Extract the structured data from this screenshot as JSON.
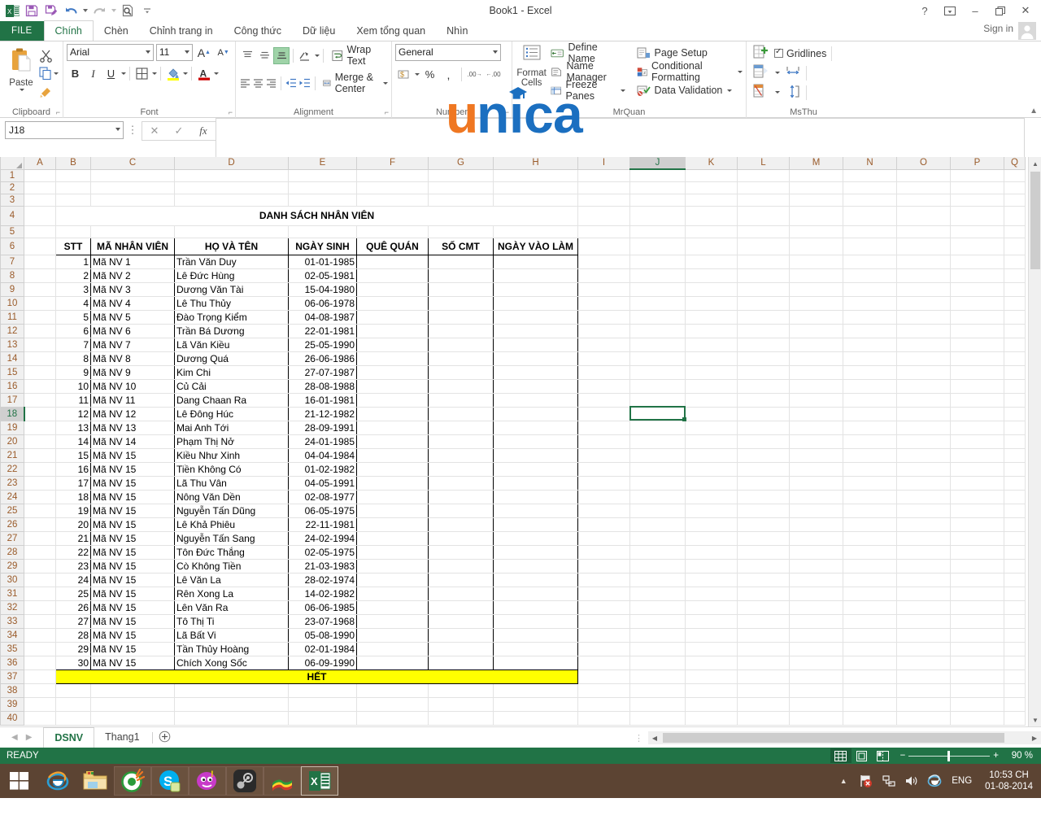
{
  "window": {
    "title": "Book1 - Excel",
    "qat": [
      {
        "name": "excel-logo-icon",
        "label": "Excel"
      },
      {
        "name": "save-icon",
        "label": "Save"
      },
      {
        "name": "save-as-icon",
        "label": "Save As"
      },
      {
        "name": "undo-icon",
        "label": "Undo"
      },
      {
        "name": "redo-icon",
        "label": "Redo"
      },
      {
        "name": "print-preview-icon",
        "label": "Print Preview"
      },
      {
        "name": "customize-qat-icon",
        "label": "Customize Quick Access Toolbar"
      }
    ],
    "buttons": {
      "help": "?",
      "ribbon_display": "ribbon-display-options",
      "minimize": "–",
      "restore": "restore",
      "close": "✕"
    },
    "sign_in": "Sign in"
  },
  "ribbon": {
    "file_tab": "FILE",
    "tabs": [
      {
        "label": "Chính",
        "active": true
      },
      {
        "label": "Chèn",
        "active": false
      },
      {
        "label": "Chỉnh trang in",
        "active": false
      },
      {
        "label": "Công thức",
        "active": false
      },
      {
        "label": "Dữ liệu",
        "active": false
      },
      {
        "label": "Xem tổng quan",
        "active": false
      },
      {
        "label": "Nhìn",
        "active": false
      }
    ],
    "groups": {
      "clipboard": {
        "label": "Clipboard",
        "paste": "Paste",
        "cut": "cut-icon",
        "copy": "copy-icon",
        "format_painter": "format-painter-icon"
      },
      "font": {
        "label": "Font",
        "font_name": "Arial",
        "font_size": "11",
        "grow_font": "A",
        "shrink_font": "A",
        "bold": "B",
        "italic": "I",
        "underline": "U",
        "borders": "borders-icon",
        "fill_color": "fill-color-icon",
        "font_color": "font-color-icon"
      },
      "alignment": {
        "label": "Alignment",
        "wrap_text": "Wrap Text",
        "merge_center": "Merge & Center",
        "orientation": "orientation-icon",
        "decrease_indent": "decrease-indent-icon",
        "increase_indent": "increase-indent-icon"
      },
      "number": {
        "label": "Number",
        "format": "General",
        "accounting": "accounting-icon",
        "percent": "%",
        "comma": ",",
        "increase_decimal": ".00",
        "decrease_decimal": ".00"
      },
      "mrquan": {
        "label": "MrQuan",
        "format_cells": "Format Cells",
        "items_left": [
          {
            "label": "Define Name",
            "icon": "define-name-icon"
          },
          {
            "label": "Name Manager",
            "icon": "name-manager-icon"
          },
          {
            "label": "Freeze Panes",
            "icon": "freeze-panes-icon",
            "dropdown": true
          }
        ],
        "items_right": [
          {
            "label": "Page Setup",
            "icon": "page-setup-icon"
          },
          {
            "label": "Conditional Formatting",
            "icon": "conditional-formatting-icon",
            "dropdown": true
          },
          {
            "label": "Data Validation",
            "icon": "data-validation-icon",
            "dropdown": true
          }
        ]
      },
      "msthu": {
        "label": "MsThu",
        "gridlines": "Gridlines",
        "gridlines_checked": true,
        "insert_cells": "insert-cells-icon",
        "format_cells2": "format-cells-icon",
        "delete_cells": "delete-cells-icon",
        "row_height": "row-height-icon",
        "column_width": "column-width-icon"
      }
    },
    "watermark_text": "unica"
  },
  "formula_bar": {
    "name_box": "J18",
    "cancel": "✕",
    "enter": "✓",
    "insert_function": "fx",
    "content": ""
  },
  "grid": {
    "columns": [
      "A",
      "B",
      "C",
      "D",
      "E",
      "F",
      "G",
      "H",
      "I",
      "J",
      "K",
      "L",
      "M",
      "N",
      "O",
      "P",
      "Q"
    ],
    "selected_column": "J",
    "selected_row": 18,
    "selected_cell": "J18",
    "title_row": 4,
    "title": "DANH SÁCH NHÂN VIÊN",
    "headers": [
      "STT",
      "MÃ NHÂN VIÊN",
      "HỌ VÀ TÊN",
      "NGÀY SINH",
      "QUÊ QUÁN",
      "SỐ CMT",
      "NGÀY VÀO LÀM"
    ],
    "header_row": 6,
    "footer_text": "HẾT",
    "footer_row": 37,
    "rows": [
      {
        "row": 7,
        "stt": "1",
        "ma": "Mã NV 1",
        "ten": "Trần Văn Duy",
        "ns": "01-01-1985"
      },
      {
        "row": 8,
        "stt": "2",
        "ma": "Mã NV 2",
        "ten": "Lê Đức Hùng",
        "ns": "02-05-1981"
      },
      {
        "row": 9,
        "stt": "3",
        "ma": "Mã NV 3",
        "ten": "Dương Văn Tài",
        "ns": "15-04-1980"
      },
      {
        "row": 10,
        "stt": "4",
        "ma": "Mã NV 4",
        "ten": "Lê Thu Thủy",
        "ns": "06-06-1978"
      },
      {
        "row": 11,
        "stt": "5",
        "ma": "Mã NV 5",
        "ten": "Đào Trọng Kiểm",
        "ns": "04-08-1987"
      },
      {
        "row": 12,
        "stt": "6",
        "ma": "Mã NV 6",
        "ten": "Trần Bá Dương",
        "ns": "22-01-1981"
      },
      {
        "row": 13,
        "stt": "7",
        "ma": "Mã NV 7",
        "ten": "Lã Văn Kiều",
        "ns": "25-05-1990"
      },
      {
        "row": 14,
        "stt": "8",
        "ma": "Mã NV 8",
        "ten": "Dương Quá",
        "ns": "26-06-1986"
      },
      {
        "row": 15,
        "stt": "9",
        "ma": "Mã NV 9",
        "ten": "Kim Chi",
        "ns": "27-07-1987"
      },
      {
        "row": 16,
        "stt": "10",
        "ma": "Mã NV 10",
        "ten": "Củ Cải",
        "ns": "28-08-1988"
      },
      {
        "row": 17,
        "stt": "11",
        "ma": "Mã NV 11",
        "ten": "Dang Chaan Ra",
        "ns": "16-01-1981"
      },
      {
        "row": 18,
        "stt": "12",
        "ma": "Mã NV 12",
        "ten": "Lê Đông Húc",
        "ns": "21-12-1982"
      },
      {
        "row": 19,
        "stt": "13",
        "ma": "Mã NV 13",
        "ten": "Mai Anh Tới",
        "ns": "28-09-1991"
      },
      {
        "row": 20,
        "stt": "14",
        "ma": "Mã NV 14",
        "ten": "Phạm Thị Nở",
        "ns": "24-01-1985"
      },
      {
        "row": 21,
        "stt": "15",
        "ma": "Mã NV 15",
        "ten": "Kiều Như Xinh",
        "ns": "04-04-1984"
      },
      {
        "row": 22,
        "stt": "16",
        "ma": "Mã NV 15",
        "ten": "Tiền Không Có",
        "ns": "01-02-1982"
      },
      {
        "row": 23,
        "stt": "17",
        "ma": "Mã NV 15",
        "ten": "Lã Thu Vân",
        "ns": "04-05-1991"
      },
      {
        "row": 24,
        "stt": "18",
        "ma": "Mã NV 15",
        "ten": "Nông Văn Dền",
        "ns": "02-08-1977"
      },
      {
        "row": 25,
        "stt": "19",
        "ma": "Mã NV 15",
        "ten": "Nguyễn Tấn Dũng",
        "ns": "06-05-1975"
      },
      {
        "row": 26,
        "stt": "20",
        "ma": "Mã NV 15",
        "ten": "Lê Khả Phiêu",
        "ns": "22-11-1981"
      },
      {
        "row": 27,
        "stt": "21",
        "ma": "Mã NV 15",
        "ten": "Nguyễn Tấn Sang",
        "ns": "24-02-1994"
      },
      {
        "row": 28,
        "stt": "22",
        "ma": "Mã NV 15",
        "ten": "Tôn Đức Thắng",
        "ns": "02-05-1975"
      },
      {
        "row": 29,
        "stt": "23",
        "ma": "Mã NV 15",
        "ten": "Cò Không Tiền",
        "ns": "21-03-1983"
      },
      {
        "row": 30,
        "stt": "24",
        "ma": "Mã NV 15",
        "ten": "Lê Văn La",
        "ns": "28-02-1974"
      },
      {
        "row": 31,
        "stt": "25",
        "ma": "Mã NV 15",
        "ten": "Rên Xong La",
        "ns": "14-02-1982"
      },
      {
        "row": 32,
        "stt": "26",
        "ma": "Mã NV 15",
        "ten": "Lên Văn Ra",
        "ns": "06-06-1985"
      },
      {
        "row": 33,
        "stt": "27",
        "ma": "Mã NV 15",
        "ten": "Tô Thị Ti",
        "ns": "23-07-1968"
      },
      {
        "row": 34,
        "stt": "28",
        "ma": "Mã NV 15",
        "ten": "Lã Bất Vi",
        "ns": "05-08-1990"
      },
      {
        "row": 35,
        "stt": "29",
        "ma": "Mã NV 15",
        "ten": "Tần Thủy Hoàng",
        "ns": "02-01-1984"
      },
      {
        "row": 36,
        "stt": "30",
        "ma": "Mã NV 15",
        "ten": "Chích Xong Sốc",
        "ns": "06-09-1990"
      }
    ]
  },
  "sheet_tabs": {
    "tabs": [
      {
        "label": "DSNV",
        "active": true
      },
      {
        "label": "Thang1",
        "active": false
      }
    ],
    "add_label": "+"
  },
  "status_bar": {
    "status": "READY",
    "views": [
      "normal-view",
      "page-layout-view",
      "page-break-view"
    ],
    "active_view": "normal-view",
    "zoom_out": "−",
    "zoom_in": "+",
    "zoom": "90 %"
  },
  "taskbar": {
    "start": "start-button",
    "apps": [
      {
        "name": "internet-explorer-icon"
      },
      {
        "name": "file-explorer-icon"
      },
      {
        "name": "unikey-icon"
      },
      {
        "name": "skype-icon"
      },
      {
        "name": "yahoo-messenger-icon"
      },
      {
        "name": "steam-icon"
      },
      {
        "name": "winrar-icon"
      },
      {
        "name": "excel-taskbar-icon"
      }
    ],
    "tray": {
      "show_hidden": "▲",
      "flag": "action-center-icon",
      "network": "network-icon",
      "volume": "volume-icon",
      "ie": "ie-tray-icon",
      "language": "ENG",
      "time": "10:53 CH",
      "date": "01-08-2014"
    }
  }
}
